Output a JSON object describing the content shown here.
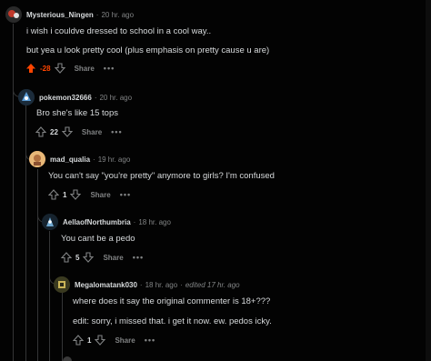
{
  "comments": [
    {
      "username": "Mysterious_Ningen",
      "time": "20 hr. ago",
      "lines": [
        "i wish i couldve dressed to school in a cool way..",
        "but yea u look pretty cool (plus emphasis on pretty cause u are)"
      ],
      "score": "-28",
      "share": "Share",
      "more": "•••",
      "colors": {
        "score": "#ff4500",
        "avatar": "#c0392b"
      }
    },
    {
      "username": "pokemon32666",
      "time": "20 hr. ago",
      "lines": [
        "Bro she's like 15 tops"
      ],
      "score": "22",
      "share": "Share",
      "more": "•••",
      "colors": {
        "avatar": "#2c5a7a"
      }
    },
    {
      "username": "mad_qualia",
      "time": "19 hr. ago",
      "lines": [
        "You can't say \"you're pretty\" anymore to girls? I'm confused"
      ],
      "score": "1",
      "share": "Share",
      "more": "•••",
      "colors": {
        "avatar": "#d9a066"
      }
    },
    {
      "username": "AellaofNorthumbria",
      "time": "18 hr. ago",
      "lines": [
        "You cant be a pedo"
      ],
      "score": "5",
      "share": "Share",
      "more": "•••",
      "colors": {
        "avatar": "#3b6e8f"
      }
    },
    {
      "username": "Megalomatank030",
      "time": "18 hr. ago",
      "edited": "edited 17 hr. ago",
      "lines": [
        "where does it say the original commenter is 18+???",
        "edit: sorry, i missed that. i get it now. ew. pedos icky."
      ],
      "score": "1",
      "share": "Share",
      "more": "•••",
      "colors": {
        "avatar": "#7a7a2a"
      }
    }
  ],
  "separator": "·"
}
